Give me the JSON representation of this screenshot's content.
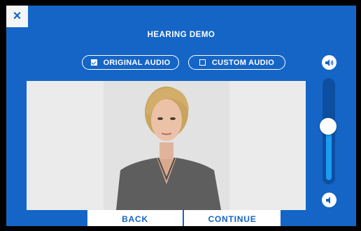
{
  "header": {
    "close_symbol": "×",
    "title": "HEARING DEMO"
  },
  "audio_toggle": {
    "original": {
      "label": "ORIGINAL AUDIO",
      "checked": true
    },
    "custom": {
      "label": "CUSTOM AUDIO",
      "checked": false
    }
  },
  "volume": {
    "level": 0.55
  },
  "footer": {
    "back_label": "BACK",
    "continue_label": "CONTINUE"
  },
  "colors": {
    "background": "#1565c7",
    "accent": "#1b9cf2",
    "button": "#ffffff"
  },
  "icons": [
    "close-icon",
    "checkbox-checked-icon",
    "checkbox-empty-icon",
    "volume-up-icon",
    "volume-down-icon"
  ]
}
